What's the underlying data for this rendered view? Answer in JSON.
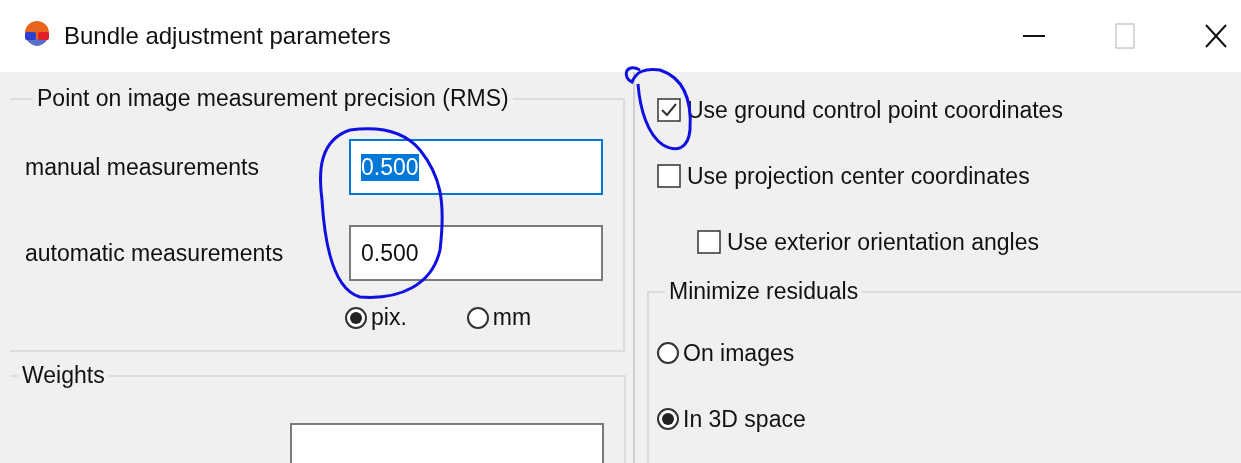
{
  "window": {
    "title": "Bundle adjustment parameters",
    "maximize_disabled": true
  },
  "precision": {
    "title": "Point on image measurement precision (RMS)",
    "fields": [
      {
        "label": "manual measurements",
        "value": "0.500",
        "focused": true
      },
      {
        "label": "automatic measurements",
        "value": "0.500",
        "focused": false
      }
    ],
    "units": [
      {
        "label": "pix.",
        "selected": true
      },
      {
        "label": "mm",
        "selected": false
      }
    ]
  },
  "weights": {
    "title": "Weights"
  },
  "options": [
    {
      "label": "Use ground control point coordinates",
      "checked": true,
      "indented": false
    },
    {
      "label": "Use projection center coordinates",
      "checked": false,
      "indented": false
    },
    {
      "label": "Use exterior orientation angles",
      "checked": false,
      "indented": true
    }
  ],
  "residuals": {
    "title": "Minimize residuals",
    "choices": [
      {
        "label": "On images",
        "selected": false
      },
      {
        "label": "In 3D space",
        "selected": true
      }
    ]
  }
}
